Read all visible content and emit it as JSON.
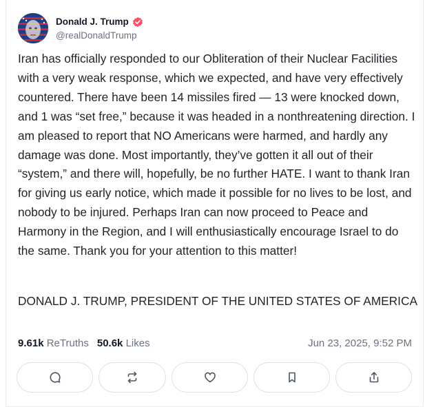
{
  "post": {
    "author": {
      "display_name": "Donald J. Trump",
      "handle": "@realDonaldTrump",
      "verified": true,
      "verified_color": "#ff4d6d",
      "avatar_icon": "flag-portrait-avatar"
    },
    "body": "Iran has officially responded to our Obliteration of their Nuclear Facilities with a very weak response, which we expected, and have very effectively countered. There have been 14 missiles fired — 13 were knocked down, and 1 was “set free,” because it was headed in a nonthreatening direction. I am pleased to report that NO Americans were harmed, and hardly any damage was done. Most importantly, they’ve gotten it all out of their “system,” and there will, hopefully, be no further HATE. I want to thank Iran for giving us early notice, which made it possible for no lives to be lost, and nobody to be injured. Perhaps Iran can now proceed to Peace and Harmony in the Region, and I will enthusiastically encourage Israel to do the same. Thank you for your attention to this matter!",
    "signature": "DONALD J. TRUMP, PRESIDENT OF THE UNITED STATES OF AMERICA",
    "stats": {
      "retruths_count": "9.61k",
      "retruths_label": "ReTruths",
      "likes_count": "50.6k",
      "likes_label": "Likes"
    },
    "timestamp": "Jun 23, 2025, 9:52 PM",
    "actions": [
      {
        "name": "reply-button",
        "icon": "comment-icon"
      },
      {
        "name": "retruth-button",
        "icon": "repost-icon"
      },
      {
        "name": "like-button",
        "icon": "heart-icon"
      },
      {
        "name": "bookmark-button",
        "icon": "bookmark-icon"
      },
      {
        "name": "share-button",
        "icon": "share-icon"
      }
    ]
  },
  "colors": {
    "text": "#1f2328",
    "muted": "#6b7280",
    "border": "#dcdfe3"
  }
}
